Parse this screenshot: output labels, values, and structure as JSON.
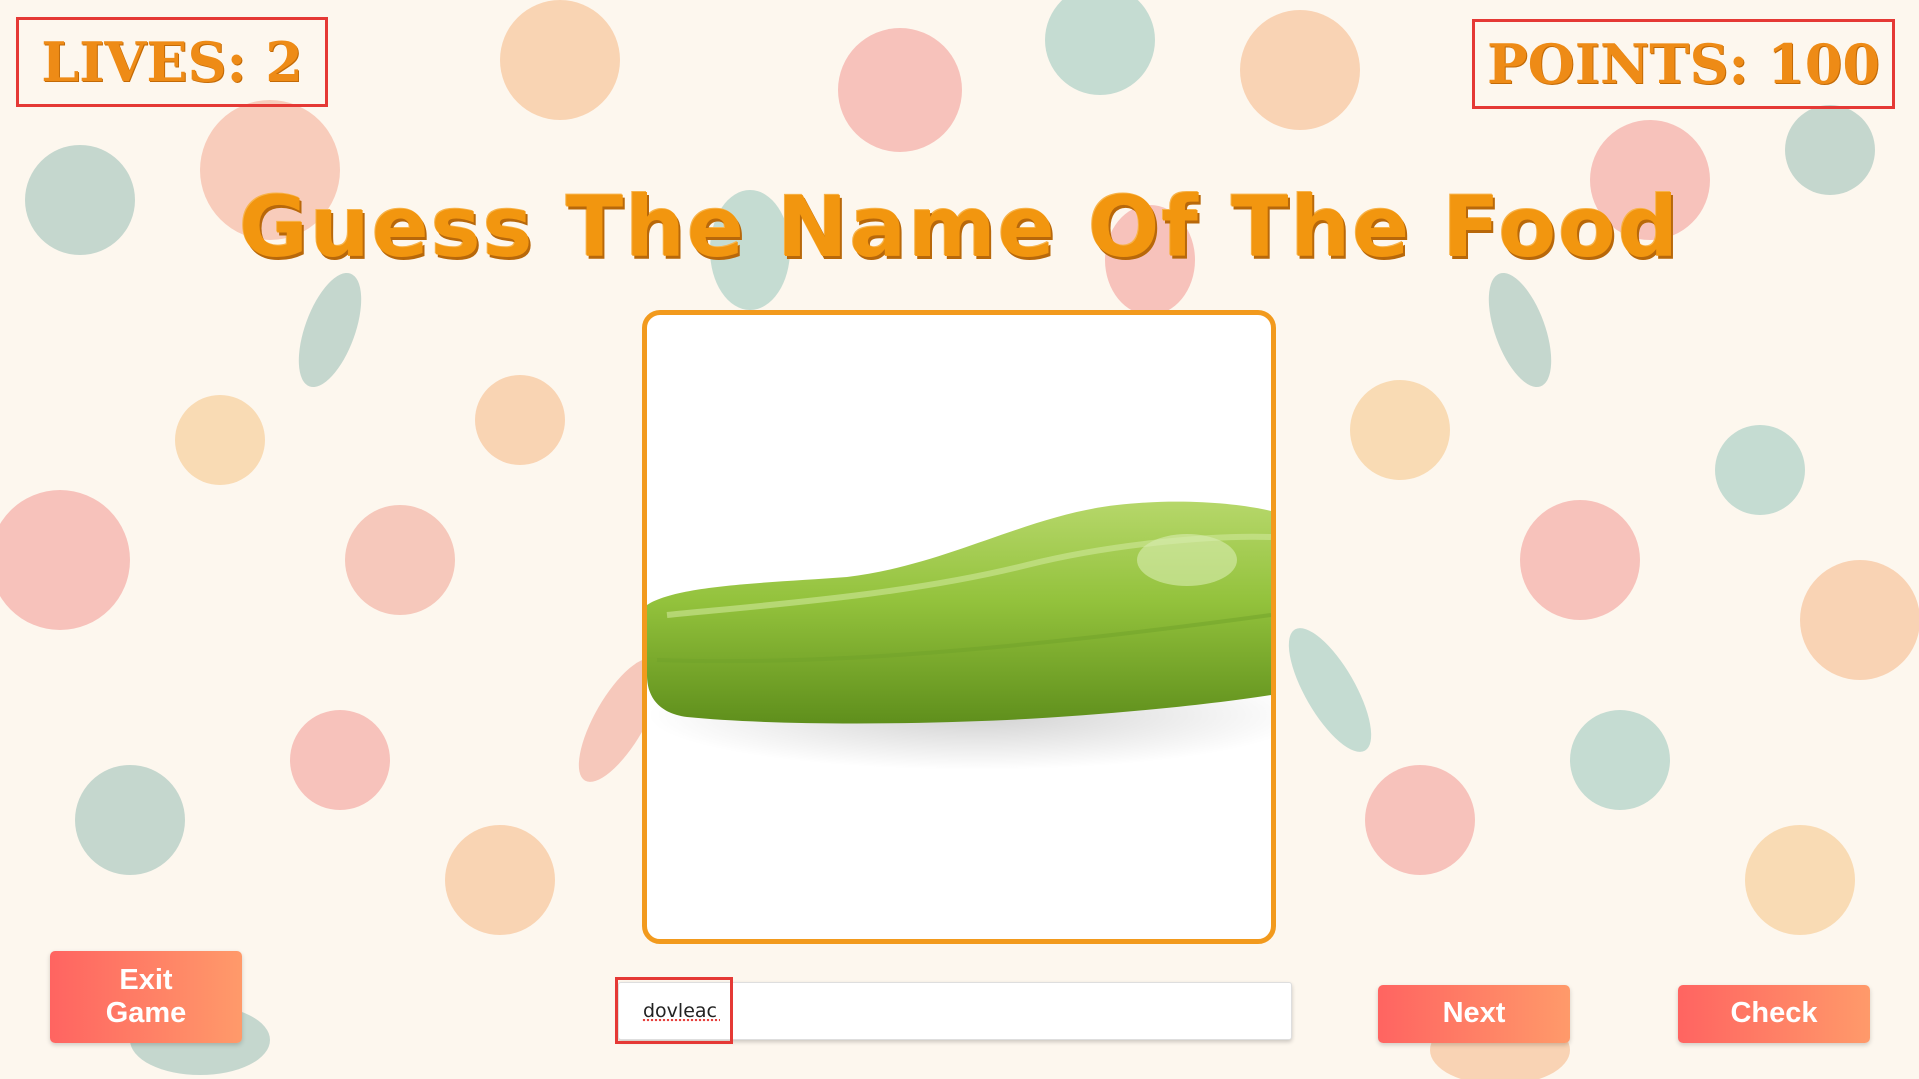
{
  "game": {
    "lives_label": "LIVES: 2",
    "points_label": "POINTS: 100",
    "title": "Guess The Name Of The Food"
  },
  "food_image": {
    "icon": "zucchini-image"
  },
  "answer": {
    "value": "dovleac"
  },
  "buttons": {
    "exit_line1": "Exit",
    "exit_line2": "Game",
    "next": "Next",
    "check": "Check"
  },
  "colors": {
    "accent": "#f29a1d",
    "button_start": "#ff6461",
    "button_end": "#ff9a6a",
    "highlight": "#e53935"
  }
}
